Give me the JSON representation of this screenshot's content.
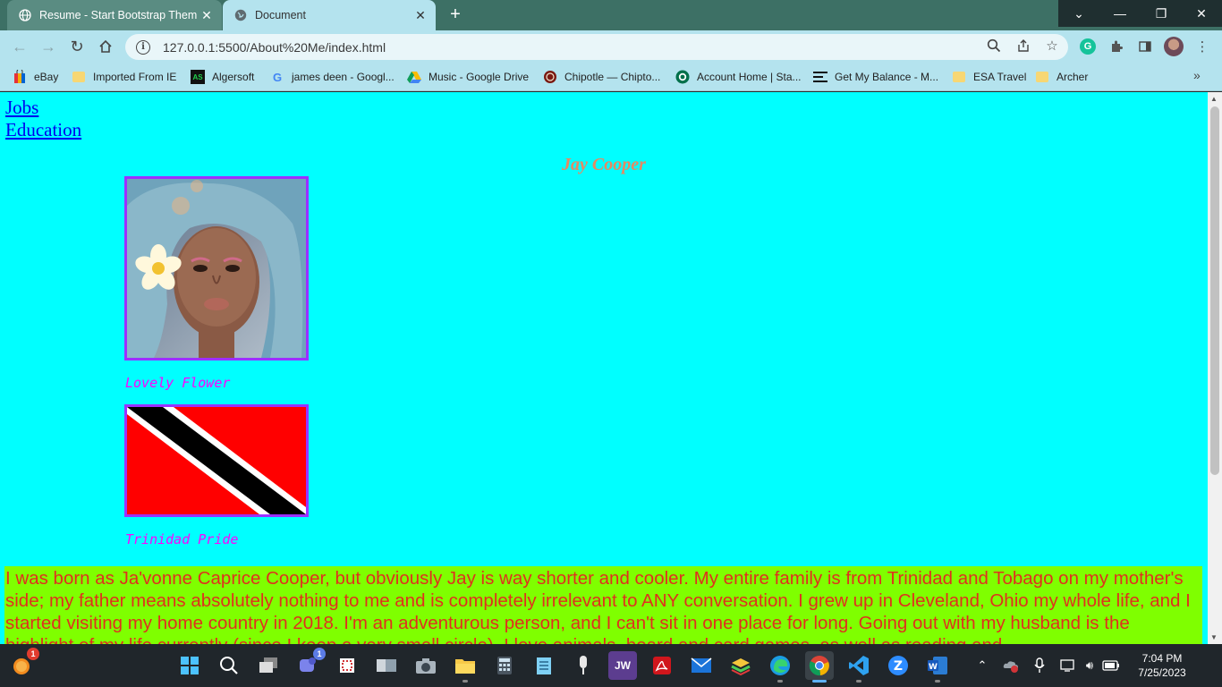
{
  "browser": {
    "tabs": [
      {
        "title": "Resume - Start Bootstrap Theme",
        "icon": "globe-icon"
      },
      {
        "title": "Document",
        "icon": "globe-icon"
      }
    ],
    "url": "127.0.0.1:5500/About%20Me/index.html",
    "bookmarks": [
      {
        "label": "eBay",
        "icon": "ebay-icon"
      },
      {
        "label": "Imported From IE",
        "icon": "folder-icon"
      },
      {
        "label": "Algersoft",
        "icon": "algersoft-icon"
      },
      {
        "label": "james deen - Googl...",
        "icon": "google-icon"
      },
      {
        "label": "Music - Google Drive",
        "icon": "google-drive-icon"
      },
      {
        "label": "Chipotle — Chipto...",
        "icon": "chipotle-icon"
      },
      {
        "label": "Account Home | Sta...",
        "icon": "starbucks-icon"
      },
      {
        "label": "Get My Balance - M...",
        "icon": "menu-icon"
      },
      {
        "label": "ESA Travel",
        "icon": "folder-icon"
      },
      {
        "label": "Archer",
        "icon": "folder-icon"
      }
    ]
  },
  "page": {
    "nav": [
      "Jobs",
      "Education"
    ],
    "name": "Jay Cooper",
    "photo_caption": "Lovely Flower",
    "flag_caption": "Trinidad Pride",
    "bio": "I was born as Ja'vonne Caprice Cooper, but obviously Jay is way shorter and cooler. My entire family is from Trinidad and Tobago on my mother's side; my father means absolutely nothing to me and is completely irrelevant to ANY conversation. I grew up in Cleveland, Ohio my whole life, and I started visiting my home country in 2018. I'm an adventurous person, and I can't sit in one place for long. Going out with my husband is the highlight of my life currently (since I keep a very small circle). I love animals, board and card games, as well as reading and"
  },
  "taskbar": {
    "time": "7:04 PM",
    "date": "7/25/2023",
    "notification_badge": "1",
    "teams_badge": "1"
  },
  "colors": {
    "page_bg": "#00ffff",
    "bio_bg": "#7fff00",
    "bio_text": "#e0301e",
    "name_color": "#e58a63",
    "caption_color": "#ff00ff",
    "frame_border": "#9b30ff"
  }
}
